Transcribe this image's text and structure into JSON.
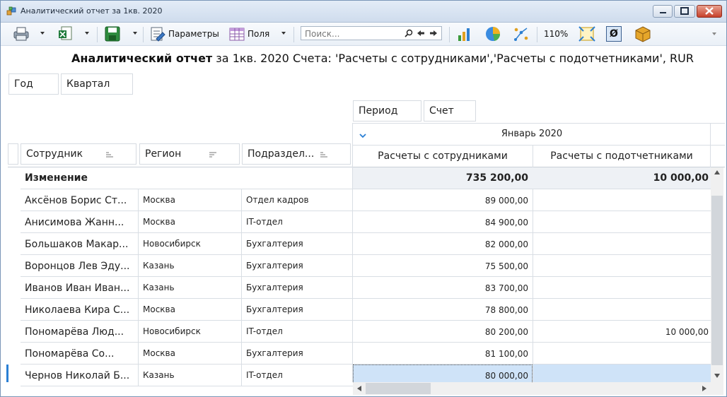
{
  "window": {
    "title": "Аналитический отчет за 1кв. 2020"
  },
  "toolbar": {
    "params_label": "Параметры",
    "fields_label": "Поля",
    "search_placeholder": "Поиск...",
    "zoom": "110%",
    "null_label": "Ø"
  },
  "report": {
    "title_bold": "Аналитический отчет",
    "title_rest": " за 1кв. 2020 Счета: 'Расчеты с сотрудниками','Расчеты с подотчетниками', RUR"
  },
  "filters": {
    "year": "Год",
    "quarter": "Квартал",
    "period": "Период",
    "account": "Счет"
  },
  "columns": {
    "employee": "Сотрудник",
    "region": "Регион",
    "department": "Подраздел...",
    "month": "Январь 2020",
    "acc1": "Расчеты с сотрудниками",
    "acc2": "Расчеты с подотчетниками"
  },
  "total": {
    "label": "Изменение",
    "acc1": "735 200,00",
    "acc2": "10 000,00"
  },
  "rows": [
    {
      "name": "Аксёнов Борис Ст...",
      "region": "Москва",
      "dept": "Отдел кадров",
      "acc1": "89 000,00",
      "acc2": ""
    },
    {
      "name": "Анисимова Жанн...",
      "region": "Москва",
      "dept": "IT-отдел",
      "acc1": "84 900,00",
      "acc2": ""
    },
    {
      "name": "Большаков Макар...",
      "region": "Новосибирск",
      "dept": "Бухгалтерия",
      "acc1": "82 000,00",
      "acc2": ""
    },
    {
      "name": "Воронцов Лев Эду...",
      "region": "Казань",
      "dept": "Бухгалтерия",
      "acc1": "75 500,00",
      "acc2": ""
    },
    {
      "name": "Иванов Иван Иван...",
      "region": "Казань",
      "dept": "Бухгалтерия",
      "acc1": "83 700,00",
      "acc2": ""
    },
    {
      "name": "Николаева Кира С...",
      "region": "Москва",
      "dept": "Бухгалтерия",
      "acc1": "78 800,00",
      "acc2": ""
    },
    {
      "name": "Пономарёва Люд...",
      "region": "Новосибирск",
      "dept": "IT-отдел",
      "acc1": "80 200,00",
      "acc2": "10 000,00"
    },
    {
      "name": "Пономарёва Со...",
      "region": "Москва",
      "dept": "Бухгалтерия",
      "acc1": "81 100,00",
      "acc2": ""
    },
    {
      "name": "Чернов Николай Б...",
      "region": "Казань",
      "dept": "IT-отдел",
      "acc1": "80 000,00",
      "acc2": ""
    }
  ],
  "colors": {
    "selection": "#cfe3f8",
    "total_bg": "#eef1f5",
    "accent": "#2a7fd4"
  }
}
